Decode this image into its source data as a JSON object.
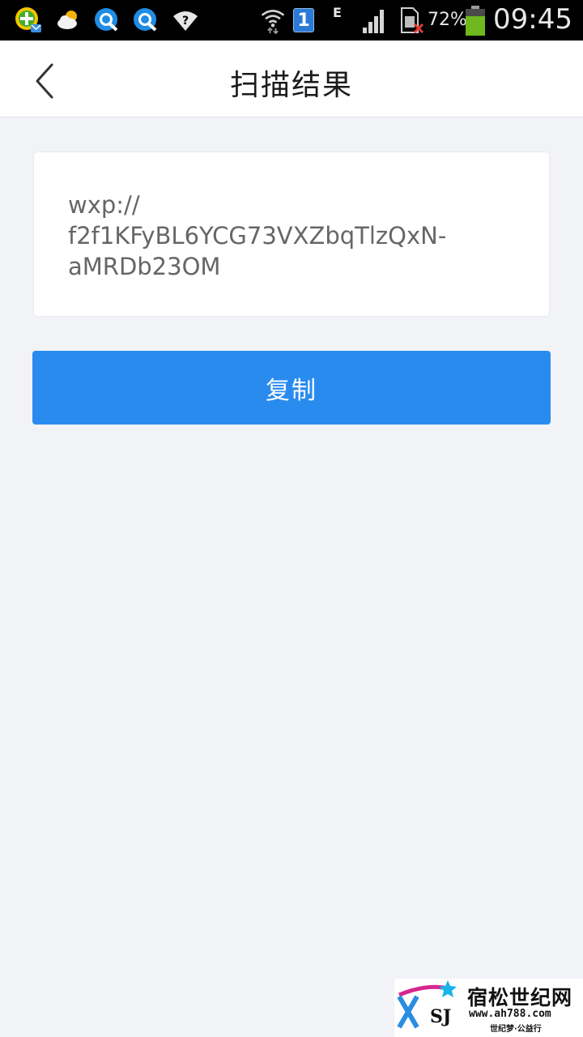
{
  "status_bar": {
    "battery_percent": "72%",
    "time": "09:45",
    "network_type": "E",
    "sim_slot": "1",
    "icons": [
      "add-mail-app-icon",
      "weather-icon",
      "browser-q-icon",
      "browser-q-icon",
      "wifi-question-icon",
      "wifi-icon",
      "sim-1-icon",
      "signal-icon",
      "no-sim-icon",
      "battery-icon"
    ]
  },
  "header": {
    "title": "扫描结果",
    "back_icon": "chevron-left-icon"
  },
  "result": {
    "lines": [
      "wxp://",
      "f2f1KFyBL6YCG73VXZbqTlzQxN-",
      "aMRDb23OM"
    ]
  },
  "actions": {
    "copy_label": "复制"
  },
  "watermark": {
    "name": "宿松世纪网",
    "url": "www.ah788.com",
    "slogan": "世纪梦·公益行",
    "logo_letters": "SJ"
  },
  "colors": {
    "accent": "#2a8bef",
    "background": "#f1f3f7",
    "battery": "#6fb81e"
  }
}
